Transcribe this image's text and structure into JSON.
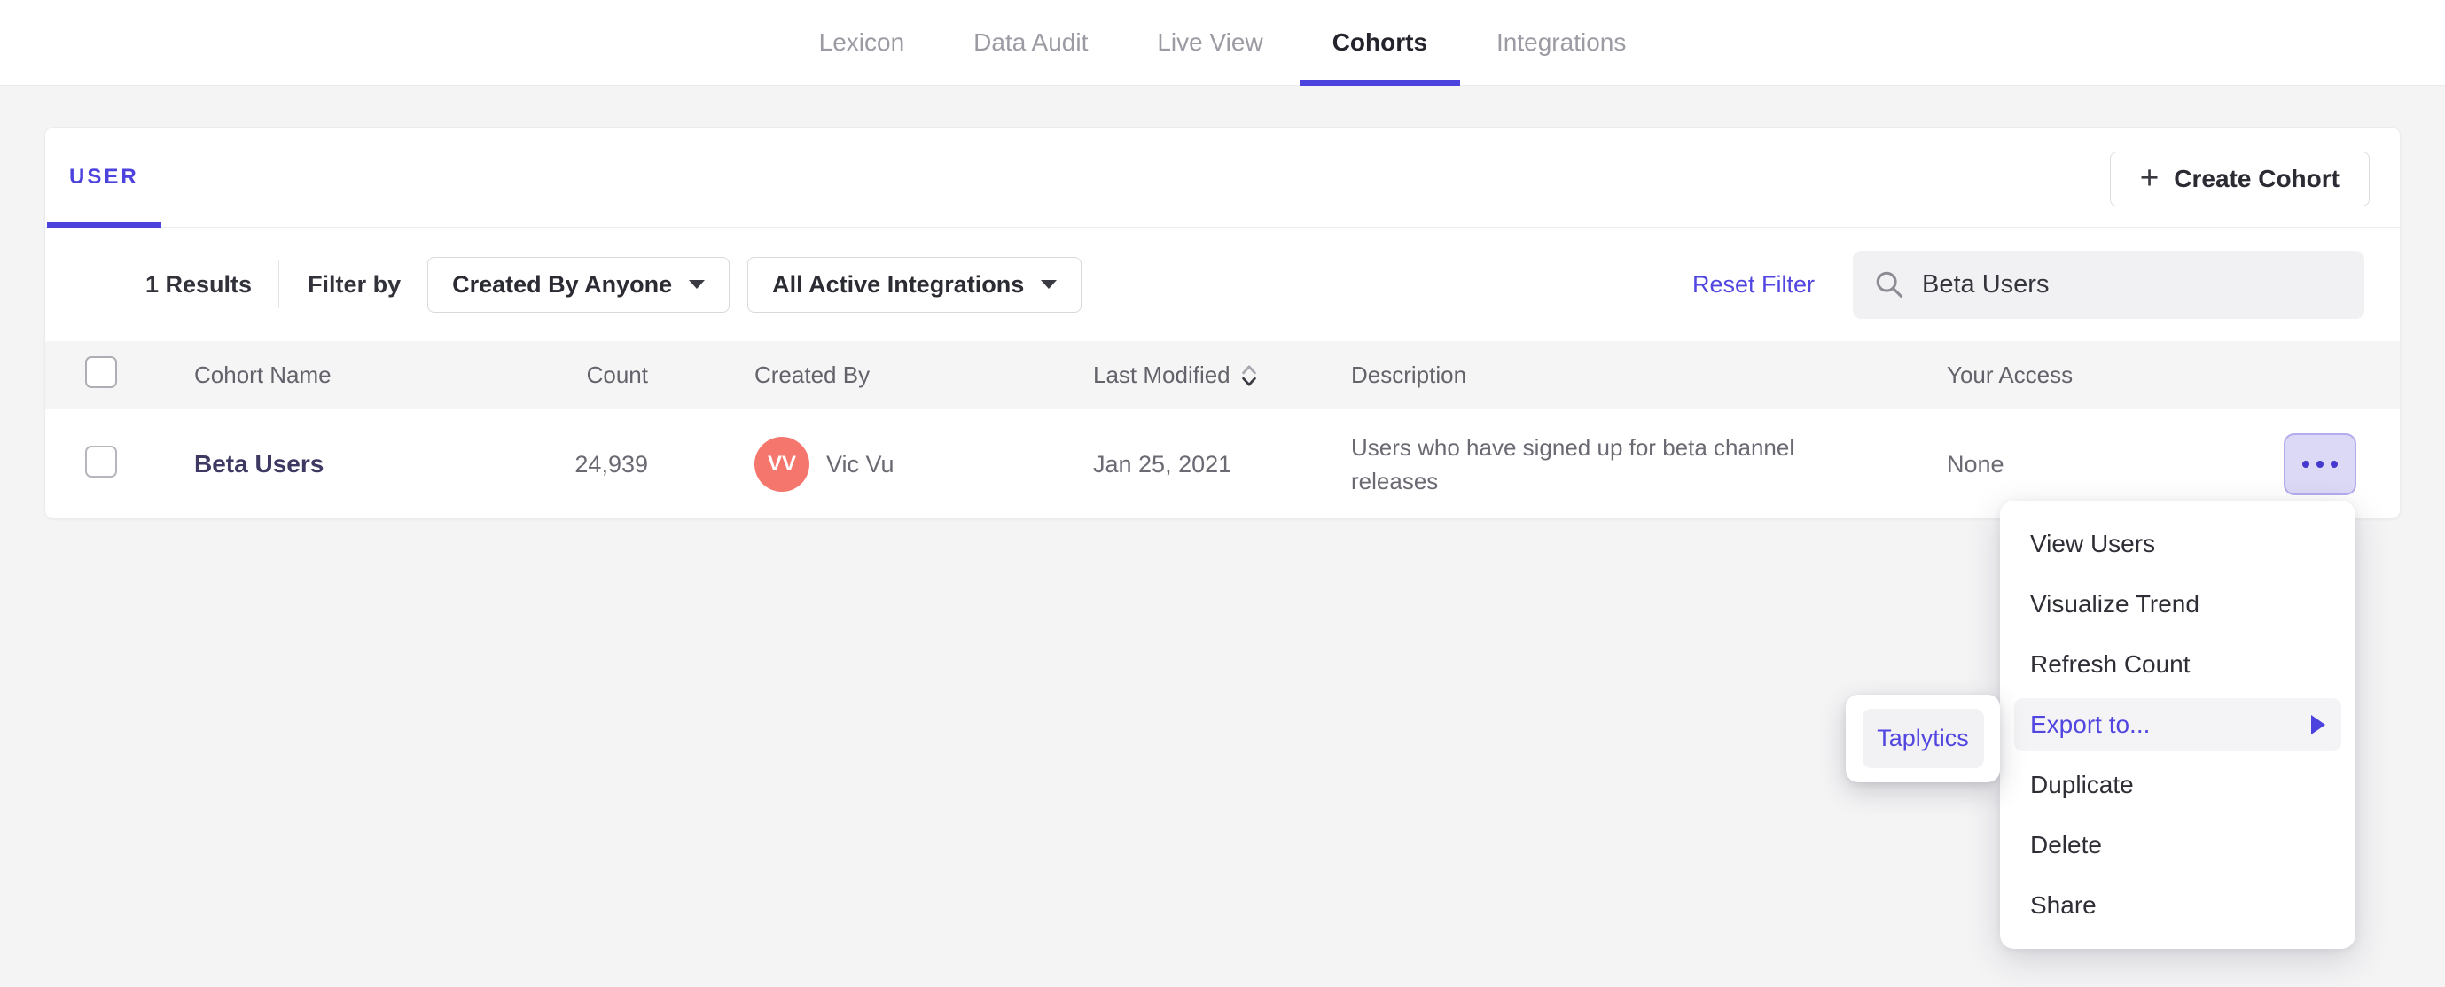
{
  "nav": {
    "tabs": [
      {
        "label": "Lexicon",
        "active": false
      },
      {
        "label": "Data Audit",
        "active": false
      },
      {
        "label": "Live View",
        "active": false
      },
      {
        "label": "Cohorts",
        "active": true
      },
      {
        "label": "Integrations",
        "active": false
      }
    ]
  },
  "card": {
    "tab_label": "USER",
    "create_button_label": "Create Cohort",
    "create_button_plus": "+",
    "filters": {
      "results_count": "1 Results",
      "filter_by_label": "Filter by",
      "created_by_dropdown": "Created By Anyone",
      "integrations_dropdown": "All Active Integrations",
      "reset_link": "Reset Filter",
      "search_value": "Beta Users"
    },
    "table": {
      "headers": {
        "name": "Cohort Name",
        "count": "Count",
        "created_by": "Created By",
        "modified": "Last Modified",
        "description": "Description",
        "access": "Your Access"
      },
      "row": {
        "name": "Beta Users",
        "count": "24,939",
        "creator_initials": "VV",
        "creator_name": "Vic Vu",
        "modified": "Jan 25, 2021",
        "description": "Users who have signed up for beta channel releases",
        "access": "None"
      }
    }
  },
  "context_menu": {
    "items": [
      {
        "label": "View Users"
      },
      {
        "label": "Visualize Trend"
      },
      {
        "label": "Refresh Count"
      },
      {
        "label": "Export to...",
        "highlighted": true,
        "has_submenu": true
      },
      {
        "label": "Duplicate"
      },
      {
        "label": "Delete"
      },
      {
        "label": "Share"
      }
    ]
  },
  "submenu": {
    "items": [
      {
        "label": "Taplytics"
      }
    ]
  },
  "colors": {
    "accent_purple": "#4c42dd",
    "link_purple": "#5246e0",
    "avatar_red": "#f5766d",
    "active_text": "#24242c",
    "inactive_text": "#9b9ba3",
    "body_text": "#6a6a73",
    "cohort_link_text": "#3d3963",
    "page_background": "#f4f4f5",
    "table_header_background": "#f5f5f6",
    "ellipsis_button_background": "#dcd9f6"
  }
}
